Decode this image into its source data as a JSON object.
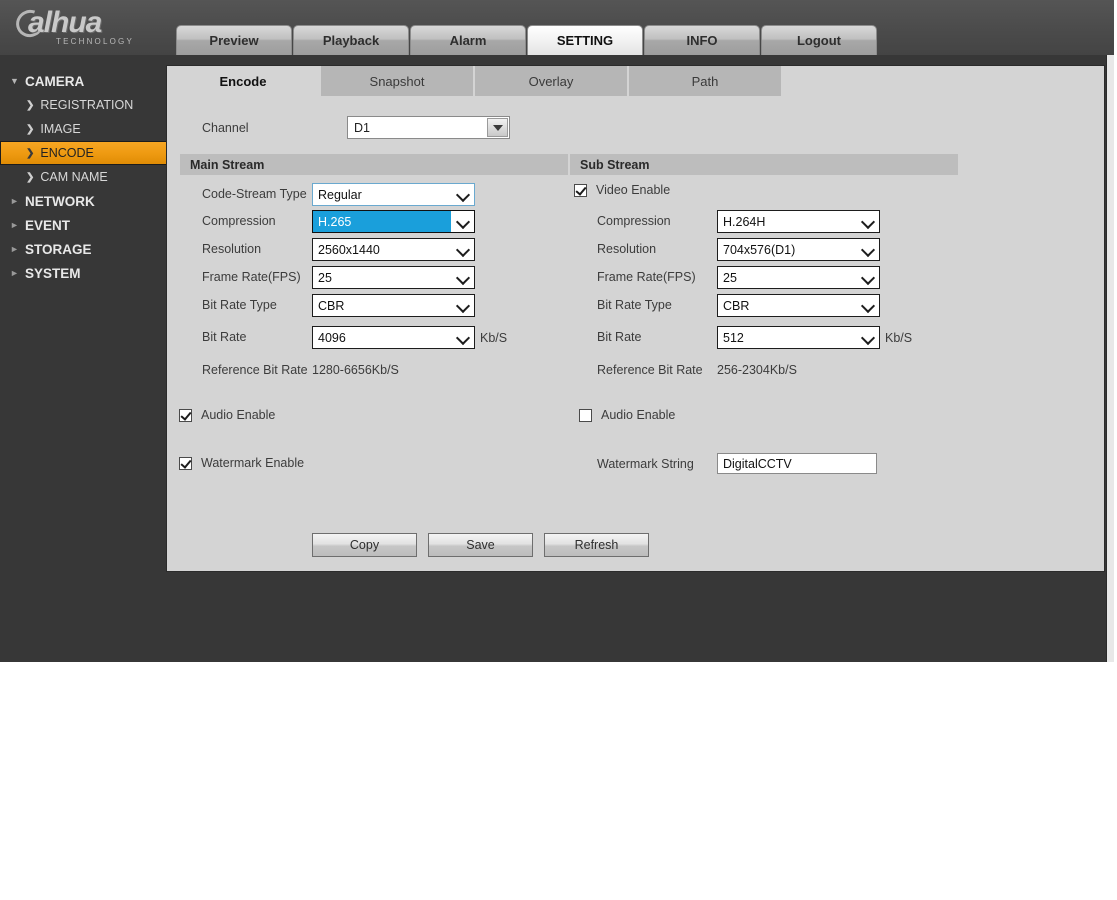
{
  "brand": {
    "name": "alhua",
    "tagline": "TECHNOLOGY"
  },
  "topnav": [
    {
      "label": "Preview",
      "active": false
    },
    {
      "label": "Playback",
      "active": false
    },
    {
      "label": "Alarm",
      "active": false
    },
    {
      "label": "SETTING",
      "active": true
    },
    {
      "label": "INFO",
      "active": false
    },
    {
      "label": "Logout",
      "active": false
    }
  ],
  "sidebar": {
    "groups": [
      {
        "label": "CAMERA",
        "expanded": true,
        "items": [
          {
            "label": "REGISTRATION",
            "active": false
          },
          {
            "label": "IMAGE",
            "active": false
          },
          {
            "label": "ENCODE",
            "active": true
          },
          {
            "label": "CAM NAME",
            "active": false
          }
        ]
      },
      {
        "label": "NETWORK",
        "expanded": false,
        "items": []
      },
      {
        "label": "EVENT",
        "expanded": false,
        "items": []
      },
      {
        "label": "STORAGE",
        "expanded": false,
        "items": []
      },
      {
        "label": "SYSTEM",
        "expanded": false,
        "items": []
      }
    ]
  },
  "subtabs": [
    {
      "label": "Encode",
      "active": true
    },
    {
      "label": "Snapshot",
      "active": false
    },
    {
      "label": "Overlay",
      "active": false
    },
    {
      "label": "Path",
      "active": false
    }
  ],
  "channel": {
    "label": "Channel",
    "value": "D1"
  },
  "main_stream": {
    "title": "Main Stream",
    "code_stream_type": {
      "label": "Code-Stream Type",
      "value": "Regular"
    },
    "compression": {
      "label": "Compression",
      "value": "H.265"
    },
    "resolution": {
      "label": "Resolution",
      "value": "2560x1440"
    },
    "frame_rate": {
      "label": "Frame Rate(FPS)",
      "value": "25"
    },
    "bit_rate_type": {
      "label": "Bit Rate Type",
      "value": "CBR"
    },
    "bit_rate": {
      "label": "Bit Rate",
      "value": "4096",
      "unit": "Kb/S"
    },
    "reference_bit_rate": {
      "label": "Reference Bit Rate",
      "value": "1280-6656Kb/S"
    },
    "audio_enable": {
      "label": "Audio Enable",
      "checked": true
    },
    "watermark_enable": {
      "label": "Watermark Enable",
      "checked": true
    }
  },
  "sub_stream": {
    "title": "Sub Stream",
    "video_enable": {
      "label": "Video Enable",
      "checked": true
    },
    "compression": {
      "label": "Compression",
      "value": "H.264H"
    },
    "resolution": {
      "label": "Resolution",
      "value": "704x576(D1)"
    },
    "frame_rate": {
      "label": "Frame Rate(FPS)",
      "value": "25"
    },
    "bit_rate_type": {
      "label": "Bit Rate Type",
      "value": "CBR"
    },
    "bit_rate": {
      "label": "Bit Rate",
      "value": "512",
      "unit": "Kb/S"
    },
    "reference_bit_rate": {
      "label": "Reference Bit Rate",
      "value": "256-2304Kb/S"
    },
    "audio_enable": {
      "label": "Audio Enable",
      "checked": false
    },
    "watermark_string": {
      "label": "Watermark String",
      "value": "DigitalCCTV"
    }
  },
  "buttons": [
    {
      "label": "Copy"
    },
    {
      "label": "Save"
    },
    {
      "label": "Refresh"
    }
  ],
  "colors": {
    "accent_orange": "#ef9b12",
    "select_blue": "#1a9fdb",
    "panel_gray": "#d4d4d4",
    "chrome_dark": "#373737"
  }
}
